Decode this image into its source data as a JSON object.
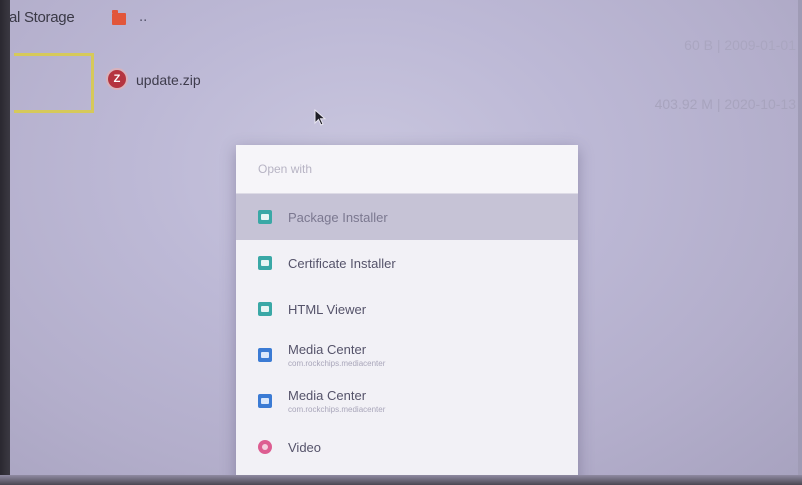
{
  "file_browser": {
    "storage_label": "al Storage",
    "folder_name": "..",
    "zip_icon_text": "Z",
    "zip_file_name": "update.zip",
    "meta_row_1": "60 B | 2009-01-01",
    "meta_row_2": "403.92 M | 2020-10-13"
  },
  "dialog": {
    "title": "Open with",
    "options": [
      {
        "label": "Package Installer",
        "icon": "app-icon",
        "selected": true
      },
      {
        "label": "Certificate Installer",
        "icon": "app-icon"
      },
      {
        "label": "HTML Viewer",
        "icon": "app-icon"
      },
      {
        "label": "Media Center",
        "sublabel": "com.rockchips.mediacenter",
        "icon": "media-icon"
      },
      {
        "label": "Media Center",
        "sublabel": "com.rockchips.mediacenter",
        "icon": "media-icon"
      },
      {
        "label": "Video",
        "icon": "video-icon"
      }
    ]
  },
  "colors": {
    "selection": "#c6c3d6",
    "app_icon": "#3aa8a6",
    "media_icon": "#3b7bd4",
    "video_icon": "#dd5d91",
    "focus_border": "#d6c95a"
  }
}
